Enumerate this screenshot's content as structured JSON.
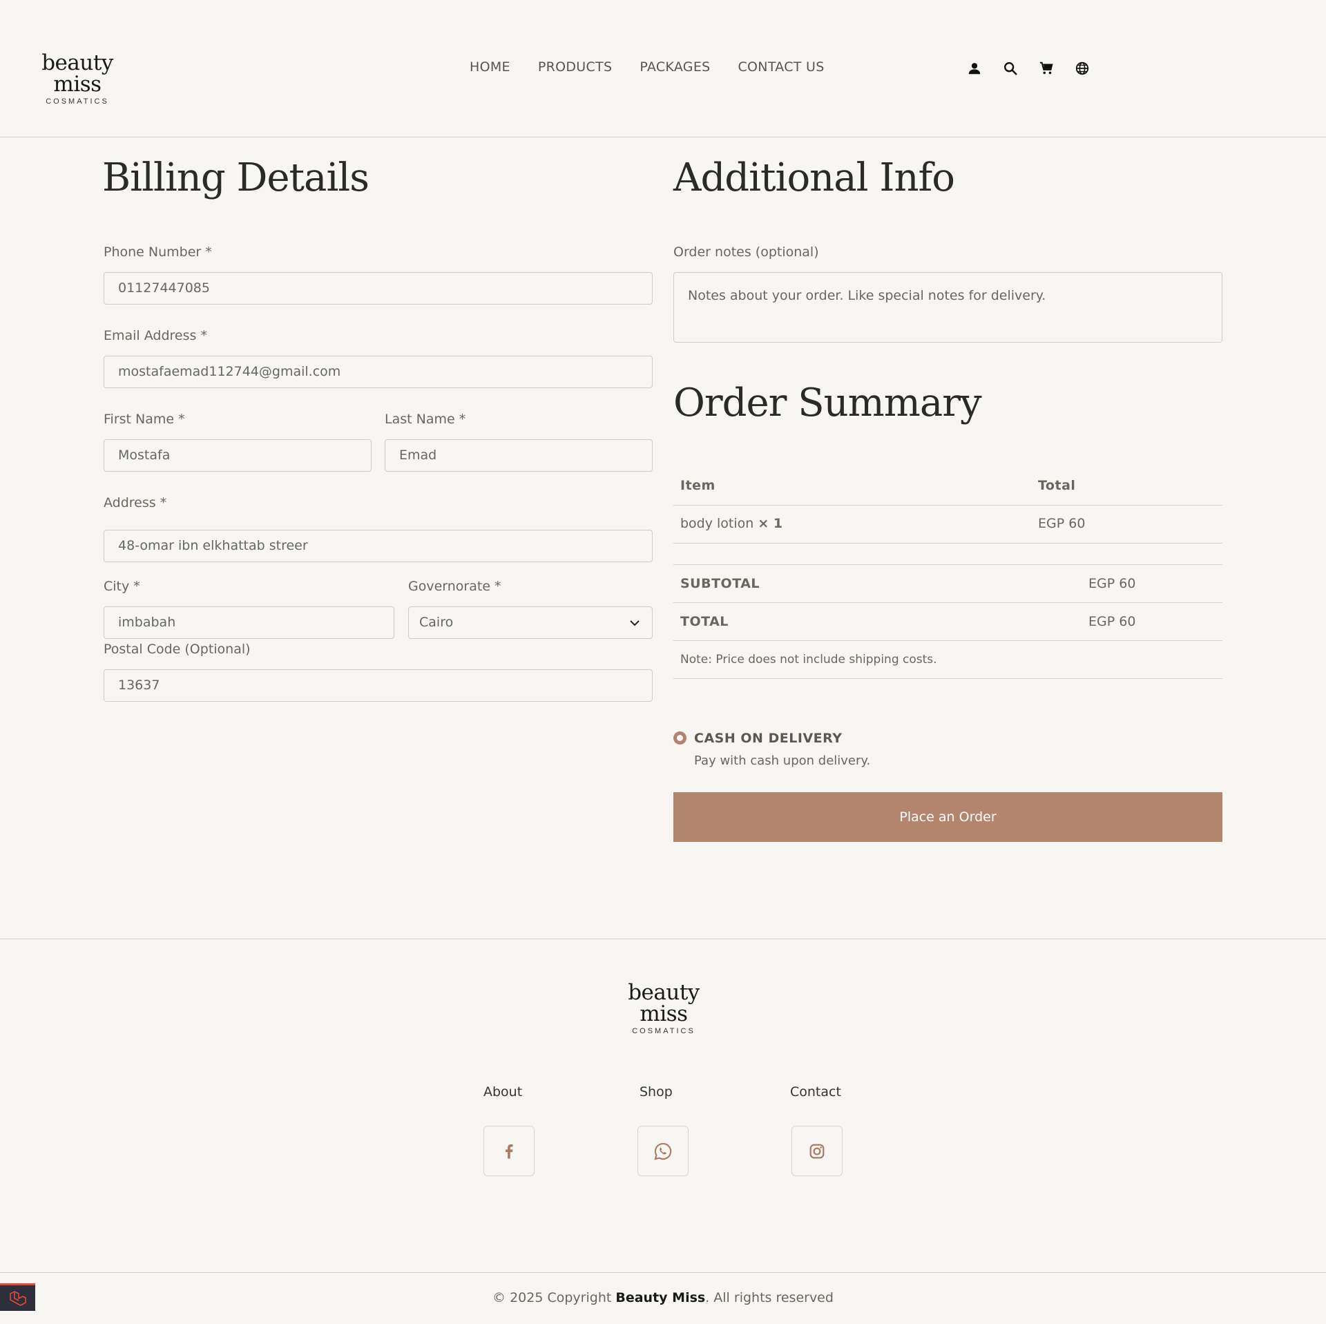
{
  "header": {
    "logo_brand": "beauty miss",
    "logo_sub": "COSMATICS",
    "nav": [
      "HOME",
      "PRODUCTS",
      "PACKAGES",
      "CONTACT US"
    ],
    "icons": [
      "user-icon",
      "search-icon",
      "cart-icon",
      "globe-icon"
    ]
  },
  "billing": {
    "title": "Billing Details",
    "phone_label": "Phone Number *",
    "phone_value": "01127447085",
    "email_label": "Email Address *",
    "email_value": "mostafaemad112744@gmail.com",
    "first_label": "First Name *",
    "first_value": "Mostafa",
    "last_label": "Last Name *",
    "last_value": "Emad",
    "address_label": "Address *",
    "address_value": "48-omar ibn elkhattab streer",
    "city_label": "City *",
    "city_value": "imbabah",
    "gov_label": "Governorate *",
    "gov_value": "Cairo",
    "postal_label": "Postal Code (Optional)",
    "postal_value": "13637"
  },
  "additional": {
    "title": "Additional Info",
    "notes_label": "Order notes (optional)",
    "notes_placeholder": "Notes about your order. Like special notes for delivery."
  },
  "summary": {
    "title": "Order Summary",
    "col_item": "Item",
    "col_total": "Total",
    "item_name": "body lotion",
    "item_qty": "× 1",
    "item_total": "EGP 60",
    "subtotal_label": "SUBTOTAL",
    "subtotal_value": "EGP 60",
    "total_label": "TOTAL",
    "total_value": "EGP 60",
    "note": "Note: Price does not include shipping costs."
  },
  "payment": {
    "method": "CASH ON DELIVERY",
    "desc": "Pay with cash upon delivery.",
    "button": "Place an Order"
  },
  "footer": {
    "logo_brand": "beauty miss",
    "logo_sub": "COSMATICS",
    "links": [
      "About",
      "Shop",
      "Contact"
    ],
    "copyright_pre": "© 2025 Copyright ",
    "copyright_brand": "Beauty Miss",
    "copyright_post": ". All rights reserved"
  },
  "colors": {
    "background": "#f8f6f3",
    "accent": "#b3856d",
    "text": "#6b6560"
  }
}
